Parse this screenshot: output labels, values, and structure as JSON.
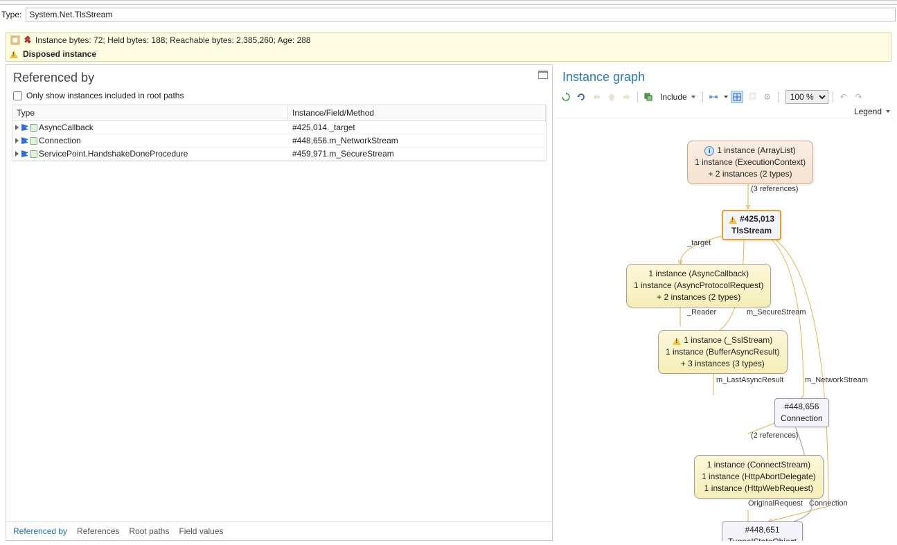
{
  "type_label": "Type:",
  "type_value": "System.Net.TlsStream",
  "info_line": "Instance bytes: 72; Held bytes: 188; Reachable bytes: 2,385,260; Age: 288",
  "disposed": "Disposed instance",
  "left": {
    "title": "Referenced by",
    "checkbox": "Only show instances included in root paths",
    "col1": "Type",
    "col2": "Instance/Field/Method",
    "rows": [
      {
        "t": "AsyncCallback",
        "i": "#425,014._target"
      },
      {
        "t": "Connection",
        "i": "#448,656.m_NetworkStream"
      },
      {
        "t": "ServicePoint.HandshakeDoneProcedure",
        "i": "#459,971.m_SecureStream"
      }
    ],
    "tabs": [
      "Referenced by",
      "References",
      "Root paths",
      "Field values"
    ]
  },
  "right": {
    "title": "Instance graph",
    "include": "Include",
    "zoom": "100 %",
    "legend": "Legend",
    "nodes": {
      "n1": {
        "l1": "1 instance (ArrayList)",
        "l2": "1 instance (ExecutionContext)",
        "l3": "+ 2 instances (2 types)"
      },
      "e1": "(3 references)",
      "n2": {
        "l1": "#425,013",
        "l2": "TlsStream"
      },
      "e2": "_target",
      "n3": {
        "l1": "1 instance (AsyncCallback)",
        "l2": "1 instance (AsyncProtocolRequest)",
        "l3": "+ 2 instances (2 types)"
      },
      "e3": "_Reader",
      "e3b": "m_SecureStream",
      "n4": {
        "l1": "1 instance (_SslStream)",
        "l2": "1 instance (BufferAsyncResult)",
        "l3": "+ 3 instances (3 types)"
      },
      "e4": "m_LastAsyncResult",
      "e4b": "m_NetworkStream",
      "n5": {
        "l1": "#448,656",
        "l2": "Connection"
      },
      "e5": "(2 references)",
      "n6": {
        "l1": "1 instance (ConnectStream)",
        "l2": "1 instance (HttpAbortDelegate)",
        "l3": "1 instance (HttpWebRequest)"
      },
      "e6": "OriginalRequest",
      "e6b": "Connection",
      "n7": {
        "l1": "#448,651",
        "l2": "TunnelStateObject"
      }
    }
  }
}
